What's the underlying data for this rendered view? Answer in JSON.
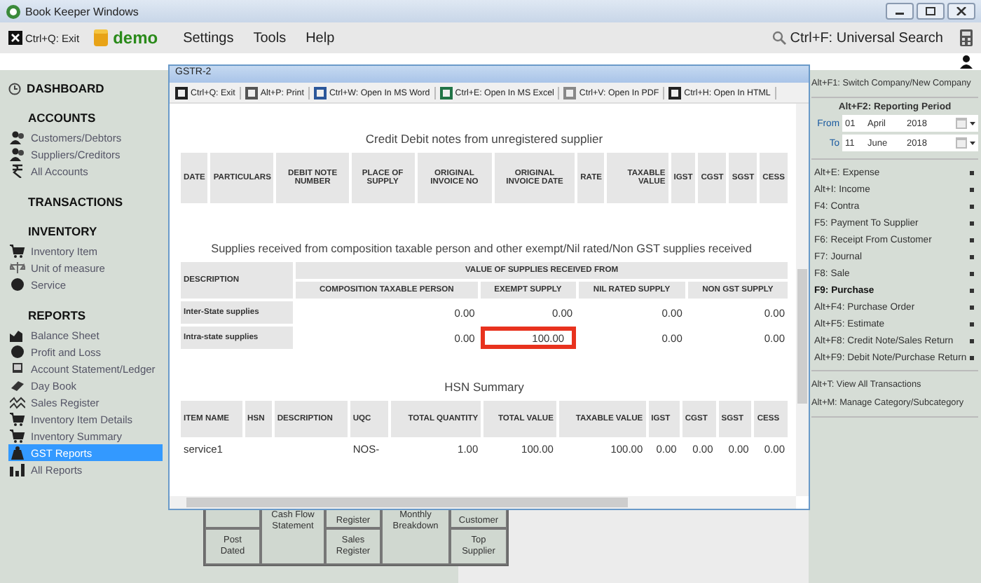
{
  "window": {
    "title": "Book Keeper Windows"
  },
  "menu_bar": {
    "exit": "Ctrl+Q: Exit",
    "company": "demo",
    "items": [
      "Settings",
      "Tools",
      "Help"
    ],
    "search": "Ctrl+F: Universal Search"
  },
  "sidebar": {
    "sections": [
      {
        "title": "DASHBOARD",
        "kind": "link"
      },
      {
        "title": "ACCOUNTS",
        "kind": "group",
        "items": [
          {
            "label": "Customers/Debtors",
            "selected": false
          },
          {
            "label": "Suppliers/Creditors",
            "selected": false
          },
          {
            "label": "All Accounts",
            "selected": false
          }
        ]
      },
      {
        "title": "TRANSACTIONS",
        "kind": "group"
      },
      {
        "title": "INVENTORY",
        "kind": "group",
        "items": [
          {
            "label": "Inventory Item",
            "selected": false
          },
          {
            "label": "Unit of measure",
            "selected": false
          },
          {
            "label": "Service",
            "selected": false
          }
        ]
      },
      {
        "title": "REPORTS",
        "kind": "group",
        "items": [
          {
            "label": "Balance Sheet",
            "selected": false
          },
          {
            "label": "Profit and Loss",
            "selected": false
          },
          {
            "label": "Account Statement/Ledger",
            "selected": false
          },
          {
            "label": "Day Book",
            "selected": false
          },
          {
            "label": "Sales Register",
            "selected": false
          },
          {
            "label": "Inventory Item Details",
            "selected": false
          },
          {
            "label": "Inventory Summary",
            "selected": false
          },
          {
            "label": "GST Reports",
            "selected": true
          },
          {
            "label": "All Reports",
            "selected": false
          }
        ]
      }
    ]
  },
  "dashboard_tiles": {
    "top": [
      "Register",
      "Customer"
    ],
    "post_dated": "Post Dated",
    "cash_flow": "Cash Flow Statement",
    "sales_register": "Sales Register",
    "monthly": "Monthly Breakdown",
    "top_supplier": "Top Supplier"
  },
  "right_panel": {
    "switch": "Alt+F1: Switch Company/New Company",
    "period": {
      "title": "Alt+F2: Reporting Period",
      "from": {
        "label": "From",
        "day": "01",
        "month": "April",
        "year": "2018"
      },
      "to": {
        "label": "To",
        "day": "11",
        "month": "June",
        "year": "2018"
      }
    },
    "actions": [
      {
        "label": "Alt+E: Expense",
        "selected": false
      },
      {
        "label": "Alt+I: Income",
        "selected": false
      },
      {
        "label": "F4: Contra",
        "selected": false
      },
      {
        "label": "F5: Payment To Supplier",
        "selected": false
      },
      {
        "label": "F6: Receipt From Customer",
        "selected": false
      },
      {
        "label": "F7: Journal",
        "selected": false
      },
      {
        "label": "F8: Sale",
        "selected": false
      },
      {
        "label": "F9: Purchase",
        "selected": true
      },
      {
        "label": "Alt+F4: Purchase Order",
        "selected": false
      },
      {
        "label": "Alt+F5: Estimate",
        "selected": false
      },
      {
        "label": "Alt+F8: Credit Note/Sales Return",
        "selected": false
      },
      {
        "label": "Alt+F9: Debit Note/Purchase Return",
        "selected": false
      }
    ],
    "links": [
      "Alt+T: View All Transactions",
      "Alt+M: Manage Category/Subcategory"
    ]
  },
  "report_window": {
    "title": "GSTR-2",
    "toolbar": [
      "Ctrl+Q: Exit",
      "Alt+P: Print",
      "Ctrl+W: Open In MS Word",
      "Ctrl+E: Open In MS Excel",
      "Ctrl+V: Open In PDF",
      "Ctrl+H: Open In HTML"
    ],
    "credit_debit": {
      "title": "Credit Debit notes from unregistered supplier",
      "columns": [
        "DATE",
        "PARTICULARS",
        "DEBIT NOTE NUMBER",
        "PLACE OF SUPPLY",
        "ORIGINAL INVOICE NO",
        "ORIGINAL INVOICE DATE",
        "RATE",
        "TAXABLE VALUE",
        "IGST",
        "CGST",
        "SGST",
        "CESS"
      ]
    },
    "composition": {
      "title": "Supplies received from composition taxable person and other exempt/Nil rated/Non GST supplies received",
      "description_header": "DESCRIPTION",
      "group_header": "VALUE OF SUPPLIES RECEIVED FROM",
      "columns": [
        "COMPOSITION TAXABLE PERSON",
        "EXEMPT SUPPLY",
        "NIL RATED SUPPLY",
        "NON GST SUPPLY"
      ],
      "rows": [
        {
          "label": "Inter-State supplies",
          "cells": [
            {
              "text": "0.00",
              "highlighted": false
            },
            {
              "text": "0.00",
              "highlighted": false
            },
            {
              "text": "0.00",
              "highlighted": false
            },
            {
              "text": "0.00",
              "highlighted": false
            }
          ]
        },
        {
          "label": "Intra-state supplies",
          "cells": [
            {
              "text": "0.00",
              "highlighted": false
            },
            {
              "text": "100.00",
              "highlighted": true
            },
            {
              "text": "0.00",
              "highlighted": false
            },
            {
              "text": "0.00",
              "highlighted": false
            }
          ]
        }
      ]
    },
    "hsn": {
      "title": "HSN Summary",
      "columns": [
        "ITEM NAME",
        "HSN",
        "DESCRIPTION",
        "UQC",
        "TOTAL QUANTITY",
        "TOTAL VALUE",
        "TAXABLE VALUE",
        "IGST",
        "CGST",
        "SGST",
        "CESS"
      ],
      "rows": [
        {
          "item_name": "service1",
          "uqc": "NOS-",
          "total_quantity": "1.00",
          "total_value": "100.00",
          "taxable_value": "100.00",
          "igst": "0.00",
          "cgst": "0.00",
          "sgst": "0.00",
          "cess": "0.00"
        }
      ]
    }
  }
}
